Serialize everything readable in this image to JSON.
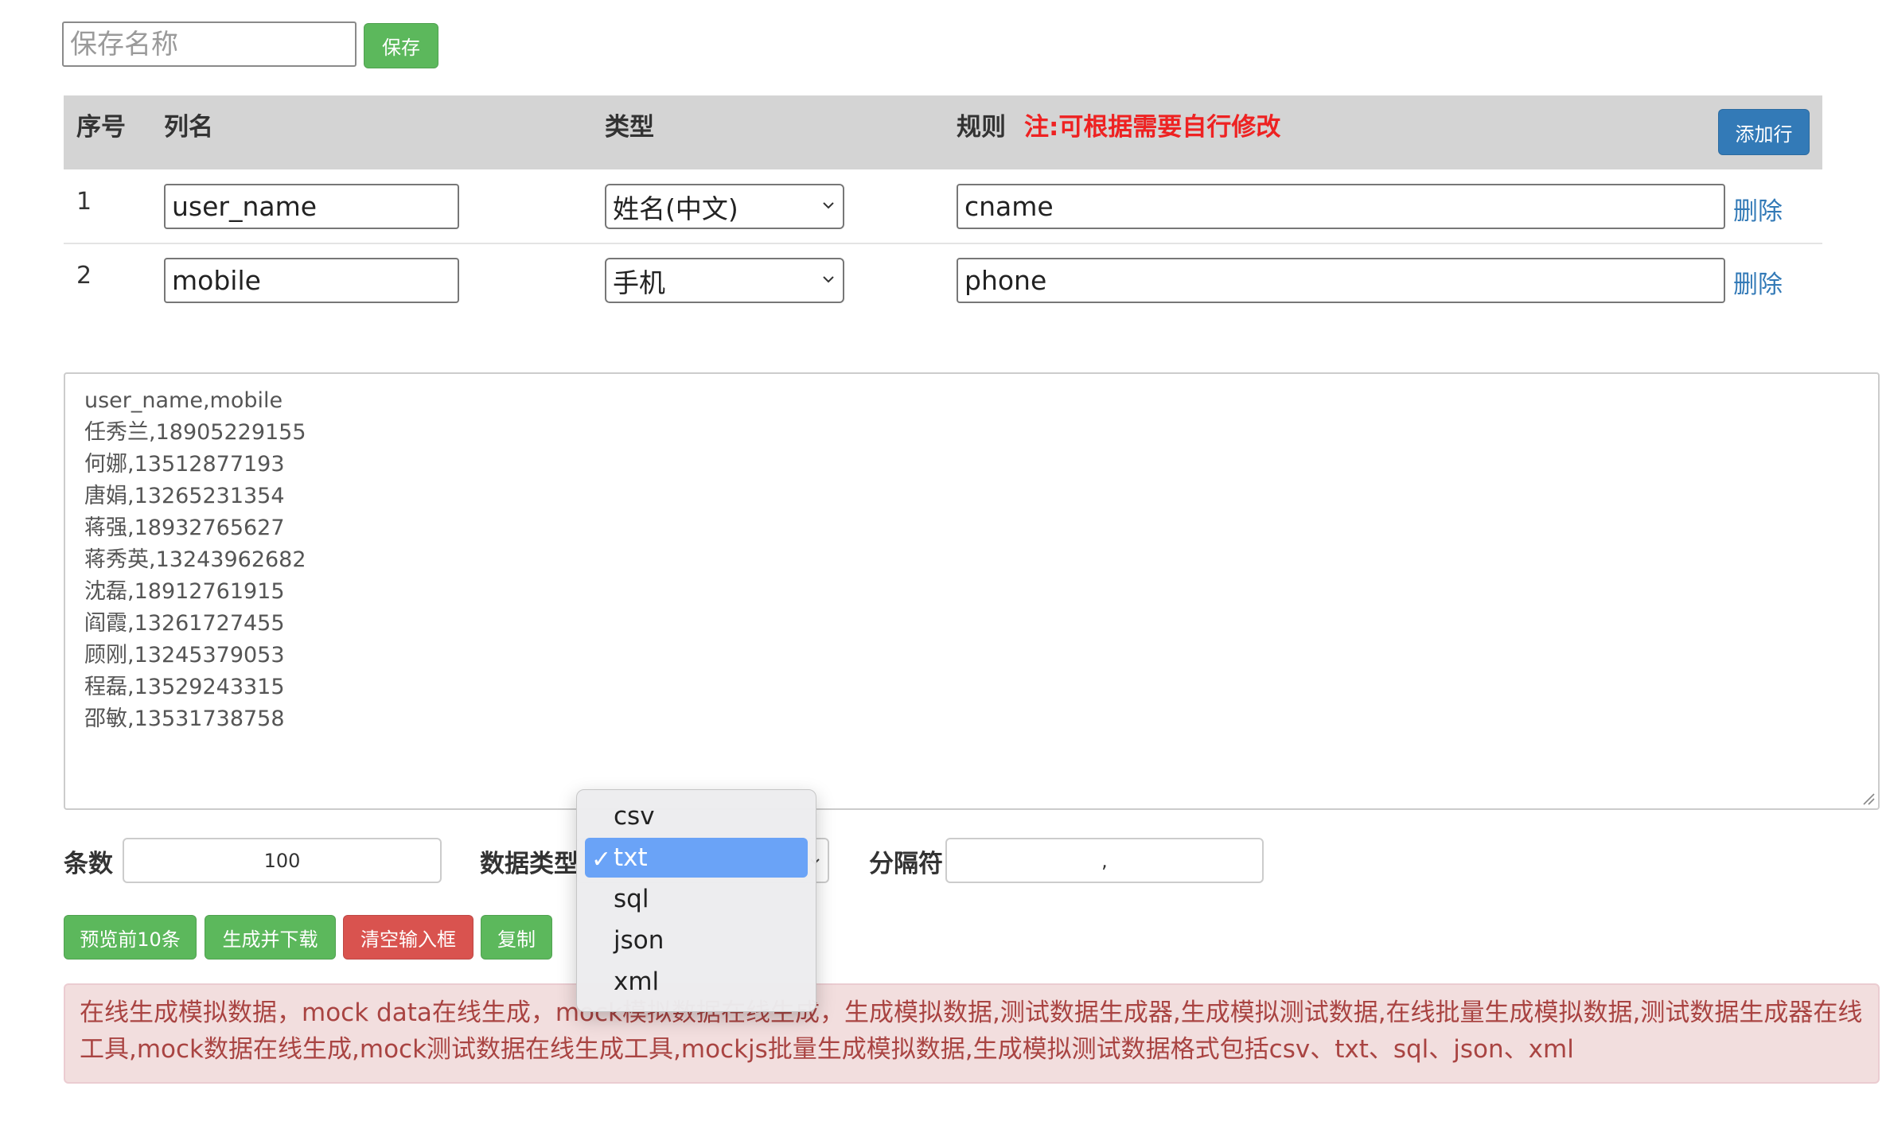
{
  "save": {
    "placeholder": "保存名称",
    "button": "保存"
  },
  "table": {
    "headers": {
      "index": "序号",
      "column": "列名",
      "type": "类型",
      "rule": "规则",
      "note": "注:可根据需要自行修改"
    },
    "add_row_button": "添加行",
    "rows": [
      {
        "index": "1",
        "column": "user_name",
        "type": "姓名(中文)",
        "rule": "cname",
        "delete": "删除"
      },
      {
        "index": "2",
        "column": "mobile",
        "type": "手机",
        "rule": "phone",
        "delete": "删除"
      }
    ]
  },
  "output": {
    "lines": [
      "user_name,mobile",
      "任秀兰,18905229155",
      "何娜,13512877193",
      "唐娟,13265231354",
      "蒋强,18932765627",
      "蒋秀英,13243962682",
      "沈磊,18912761915",
      "阎霞,13261727455",
      "顾刚,13245379053",
      "程磊,13529243315",
      "邵敏,13531738758"
    ]
  },
  "options": {
    "count_label": "条数",
    "count_value": "100",
    "datatype_label": "数据类型",
    "separator_label": "分隔符",
    "separator_value": ","
  },
  "actions": {
    "preview": "预览前10条",
    "generate": "生成并下载",
    "clear": "清空输入框",
    "copy": "复制"
  },
  "dropdown": {
    "options": [
      "csv",
      "txt",
      "sql",
      "json",
      "xml"
    ],
    "selected": "txt"
  },
  "notice": {
    "text": "在线生成模拟数据，mock data在线生成，mock模拟数据在线生成，生成模拟数据,测试数据生成器,生成模拟测试数据,在线批量生成模拟数据,测试数据生成器在线工具,mock数据在线生成,mock测试数据在线生成工具,mockjs批量生成模拟数据,生成模拟测试数据格式包括csv、txt、sql、json、xml"
  },
  "colors": {
    "green": "#5cb85c",
    "red": "#d9534f",
    "blue": "#337ab7",
    "note_red": "#ee2222",
    "notice_bg": "#f2dede",
    "notice_text": "#a94442",
    "dropdown_selected": "#6aa3f7"
  }
}
